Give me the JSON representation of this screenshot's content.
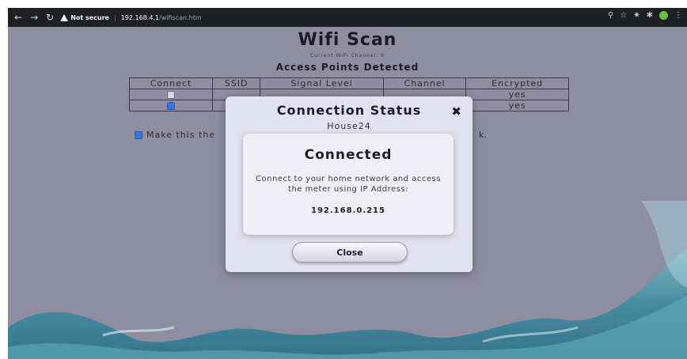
{
  "browser": {
    "nav_icons": [
      "back-icon",
      "forward-icon",
      "reload-icon"
    ],
    "security_label": "Not secure",
    "url_host": "192.168.4.1",
    "url_path": "/wifiscan.htm",
    "toolbar_icons": [
      "zoom-icon",
      "bookmark-star-icon",
      "extension-icon",
      "puzzle-icon",
      "profile-icon",
      "menu-icon"
    ]
  },
  "page": {
    "title": "Wifi Scan",
    "current_channel": "Current WiFi Channel: 9",
    "section_heading": "Access Points Detected",
    "table": {
      "headers": [
        "Connect",
        "SSID",
        "Signal Level",
        "Channel",
        "Encrypted"
      ],
      "rows": [
        {
          "selected": false,
          "encrypted": "yes"
        },
        {
          "selected": true,
          "encrypted": "yes"
        }
      ]
    },
    "default_checkbox_label": "Make this the",
    "default_checkbox_tail": "k."
  },
  "modal": {
    "title": "Connection Status",
    "ssid": "House24",
    "status": "Connected",
    "message": "Connect to your home network and access the meter using IP Address:",
    "ip": "192.168.0.215",
    "close_button": "Close",
    "close_icon": "close-icon"
  },
  "colors": {
    "background": "#8f8da0",
    "modal": "#e2e1ef",
    "checkbox_checked": "#3b73d9"
  }
}
